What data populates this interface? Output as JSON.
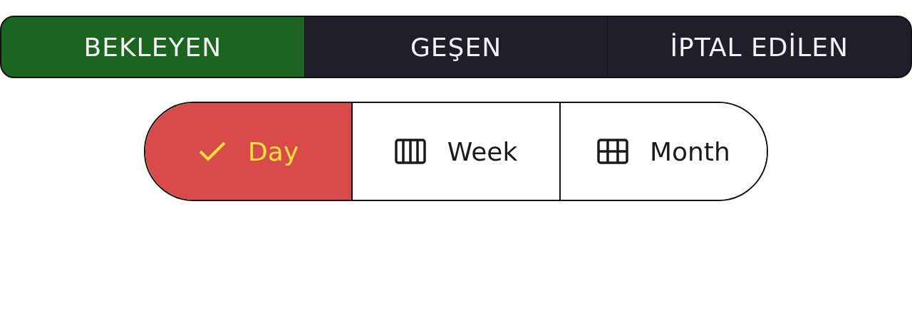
{
  "status_tabs": [
    {
      "label": "BEKLEYEN",
      "selected": true
    },
    {
      "label": "GEŞEN",
      "selected": false
    },
    {
      "label": "İPTAL EDİLEN",
      "selected": false
    }
  ],
  "view_switch": [
    {
      "label": "Day",
      "kind": "day",
      "selected": true
    },
    {
      "label": "Week",
      "kind": "week",
      "selected": false
    },
    {
      "label": "Month",
      "kind": "month",
      "selected": false
    }
  ]
}
